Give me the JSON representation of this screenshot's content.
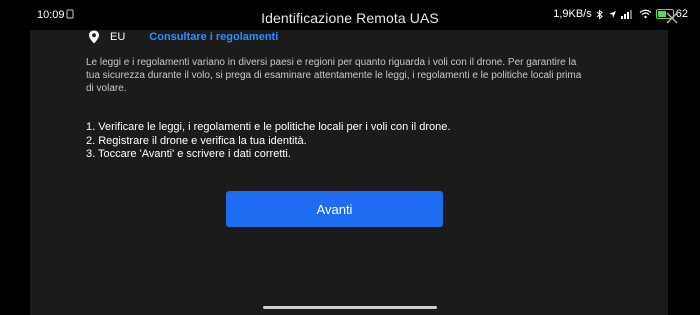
{
  "status_bar": {
    "time": "10:09",
    "notification_icon": "sim-icon",
    "speed": "1,9KB/s",
    "icons": [
      "bluetooth-icon",
      "location-icon",
      "signal-icon",
      "wifi-icon",
      "battery-icon"
    ],
    "battery_percent": "62",
    "battery_level": 0.62,
    "battery_color": "#66cc66"
  },
  "header": {
    "title": "Identificazione Remota UAS",
    "close_icon": "close-icon"
  },
  "region": {
    "icon": "location-pin-icon",
    "code": "EU",
    "link_label": "Consultare i regolamenti",
    "link_color": "#2f8cff"
  },
  "description": "Le leggi e i regolamenti variano in diversi paesi e regioni per quanto riguarda i voli con il drone. Per garantire la tua sicurezza durante il volo, si prega di esaminare attentamente le leggi, i regolamenti e le politiche locali prima di volare.",
  "steps": [
    "1. Verificare le leggi, i regolamenti e le politiche locali per i voli con il drone.",
    "2. Registrare il drone e verifica la tua identità.",
    "3. Toccare 'Avanti' e scrivere i dati corretti."
  ],
  "primary_button": {
    "label": "Avanti",
    "color": "#1e6cf0"
  }
}
